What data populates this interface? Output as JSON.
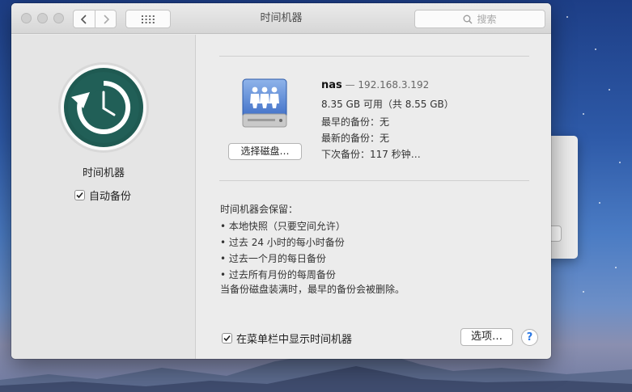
{
  "window": {
    "title": "时间机器"
  },
  "toolbar": {
    "search_placeholder": "搜索"
  },
  "sidebar": {
    "title": "时间机器",
    "auto_backup_label": "自动备份",
    "auto_backup_checked": true
  },
  "disk": {
    "name": "nas",
    "separator": "—",
    "address": "192.168.3.192",
    "capacity": "8.35 GB 可用（共 8.55 GB）",
    "oldest_backup": "最早的备份：无",
    "latest_backup": "最新的备份：无",
    "next_backup": "下次备份：117 秒钟…",
    "select_disk_label": "选择磁盘…"
  },
  "keeps": {
    "title": "时间机器会保留：",
    "items": [
      "• 本地快照（只要空间允许）",
      "• 过去 24 小时的每小时备份",
      "• 过去一个月的每日备份",
      "• 过去所有月份的每周备份"
    ],
    "note": "当备份磁盘装满时，最早的备份会被删除。"
  },
  "footer": {
    "show_in_menubar_label": "在菜单栏中显示时间机器",
    "show_in_menubar_checked": true,
    "options_label": "选项…",
    "help_label": "?"
  },
  "colors": {
    "tm_icon": "#1f5a52",
    "accent": "#2b78e4"
  }
}
